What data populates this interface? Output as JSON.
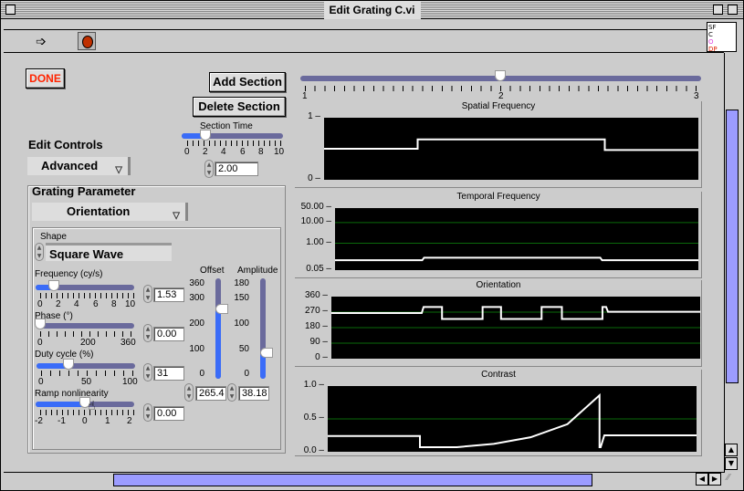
{
  "window": {
    "title": "Edit Grating C.vi"
  },
  "toolbar": {
    "run_icon": "run-arrow-icon",
    "stop_icon": "stop-icon",
    "vi_icon_text": [
      "SF",
      "C",
      "O",
      "DP"
    ]
  },
  "buttons": {
    "done": "DONE",
    "add_section": "Add Section",
    "delete_section": "Delete Section"
  },
  "section_time": {
    "label": "Section Time",
    "value": "2.00",
    "min": 0,
    "max": 10,
    "ticks": [
      "0",
      "2",
      "4",
      "6",
      "8",
      "10"
    ],
    "position": 2.0
  },
  "section_slider": {
    "ticks": [
      "1",
      "2",
      "3"
    ],
    "position": 2.0,
    "min": 1,
    "max": 3
  },
  "edit_controls": {
    "label": "Edit Controls",
    "selected": "Advanced"
  },
  "grating_parameter": {
    "label": "Grating Parameter",
    "selected": "Orientation"
  },
  "shape": {
    "label": "Shape",
    "value": "Square Wave"
  },
  "frequency": {
    "label": "Frequency (cy/s)",
    "value": "1.53",
    "ticks": [
      "0",
      "2",
      "4",
      "6",
      "8",
      "10"
    ],
    "position": 1.53,
    "min": 0,
    "max": 10
  },
  "phase": {
    "label": "Phase (°)",
    "value": "0.00",
    "ticks": [
      "0",
      "200",
      "360"
    ],
    "position": 0,
    "min": 0,
    "max": 360
  },
  "duty_cycle": {
    "label": "Duty cycle (%)",
    "value": "31",
    "ticks": [
      "0",
      "50",
      "100"
    ],
    "position": 31,
    "min": 0,
    "max": 100
  },
  "ramp": {
    "label": "Ramp nonlinearity",
    "value": "0.00",
    "ticks": [
      "-2",
      "-1",
      "0",
      "1",
      "2"
    ],
    "position": 0,
    "min": -2,
    "max": 2
  },
  "offset": {
    "label": "Offset",
    "value": "265.4",
    "ticks": [
      "360",
      "300",
      "200",
      "100",
      "0"
    ],
    "position": 265.4,
    "min": 0,
    "max": 360
  },
  "amplitude": {
    "label": "Amplitude",
    "value": "38.18",
    "ticks": [
      "180",
      "150",
      "100",
      "50",
      "0"
    ],
    "position": 38.18,
    "min": 0,
    "max": 180
  },
  "chart_data": [
    {
      "type": "line",
      "title": "Spatial Frequency",
      "yticks": [
        "1",
        "0"
      ],
      "ylim": [
        0,
        1
      ],
      "grid": false,
      "x": [
        0,
        0.25,
        0.25,
        0.75,
        0.75,
        1.0
      ],
      "values": [
        0.5,
        0.5,
        0.65,
        0.65,
        0.48,
        0.48
      ]
    },
    {
      "type": "line",
      "title": "Temporal Frequency",
      "yticks": [
        "50.00",
        "10.00",
        "1.00",
        "0.05"
      ],
      "yscale": "log",
      "ylim": [
        0.05,
        50
      ],
      "grid": true,
      "x": [
        0,
        0.24,
        0.245,
        0.73,
        0.735,
        1.0
      ],
      "values": [
        0.15,
        0.15,
        0.2,
        0.2,
        0.15,
        0.15
      ]
    },
    {
      "type": "line",
      "title": "Orientation",
      "yticks": [
        "360",
        "270",
        "180",
        "90",
        "0"
      ],
      "ylim": [
        0,
        360
      ],
      "grid": true,
      "x": [
        0,
        0.245,
        0.25,
        0.3,
        0.3,
        0.41,
        0.41,
        0.46,
        0.46,
        0.57,
        0.57,
        0.625,
        0.625,
        0.735,
        0.735,
        0.745,
        0.75,
        1.0
      ],
      "values": [
        265,
        265,
        300,
        300,
        230,
        230,
        300,
        300,
        230,
        230,
        300,
        300,
        230,
        230,
        300,
        300,
        272,
        272
      ]
    },
    {
      "type": "line",
      "title": "Contrast",
      "yticks": [
        "1.0",
        "0.5",
        "0.0"
      ],
      "ylim": [
        0,
        1
      ],
      "grid": true,
      "x": [
        0,
        0.25,
        0.25,
        0.35,
        0.45,
        0.55,
        0.65,
        0.737,
        0.737,
        0.74,
        0.75,
        0.75,
        1.0
      ],
      "values": [
        0.24,
        0.24,
        0.07,
        0.07,
        0.12,
        0.22,
        0.42,
        0.86,
        0.07,
        0.07,
        0.25,
        0.25,
        0.25
      ]
    }
  ]
}
